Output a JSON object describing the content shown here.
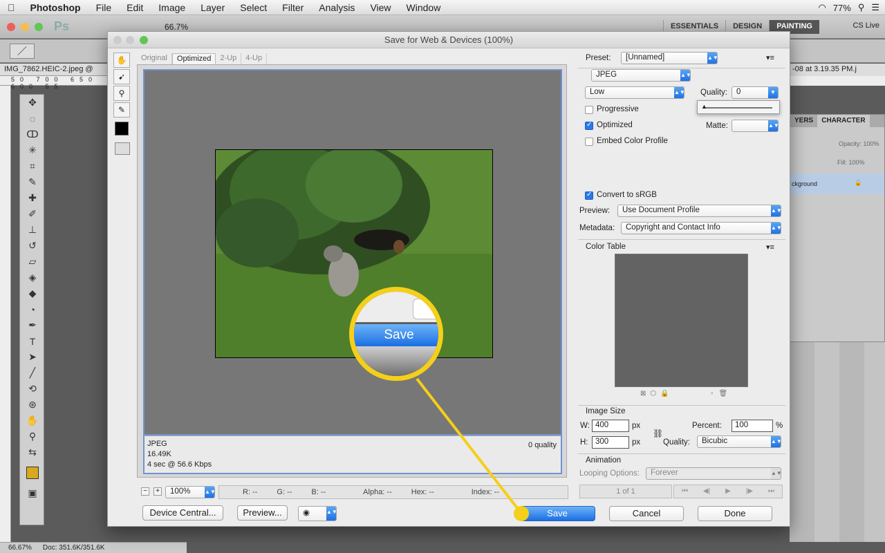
{
  "menubar": {
    "app": "Photoshop",
    "items": [
      "File",
      "Edit",
      "Image",
      "Layer",
      "Select",
      "Filter",
      "Analysis",
      "View",
      "Window"
    ],
    "battery": "77%"
  },
  "ps": {
    "zoom": "66.7%",
    "workspaces": [
      "ESSENTIALS",
      "DESIGN",
      "PAINTING"
    ],
    "cs_live": "CS Live",
    "doc_tab": "IMG_7862.HEIC-2.jpeg @",
    "ruler": "50 700 650 600 55",
    "status_zoom": "66.67%",
    "status_doc": "Doc: 351.6K/351.6K"
  },
  "bg": {
    "title": "-08 at 3.19.35 PM.j",
    "tabs": [
      "YERS",
      "CHARACTER"
    ],
    "opacity": "Opacity:",
    "opacity_val": "100%",
    "fill": "Fill:",
    "fill_val": "100%",
    "layer": "ckground"
  },
  "dialog": {
    "title": "Save for Web & Devices (100%)",
    "tabs": [
      "Original",
      "Optimized",
      "2-Up",
      "4-Up"
    ],
    "info": {
      "format": "JPEG",
      "size": "16.49K",
      "time": "4 sec @ 56.6 Kbps",
      "quality": "0 quality"
    },
    "zoom": "100%",
    "readouts": {
      "r": "R: --",
      "g": "G: --",
      "b": "B: --",
      "alpha": "Alpha: --",
      "hex": "Hex: --",
      "index": "Index: --"
    },
    "buttons": {
      "device_central": "Device Central...",
      "preview": "Preview...",
      "save": "Save",
      "cancel": "Cancel",
      "done": "Done"
    },
    "magnifier_label": "Save",
    "settings": {
      "preset_label": "Preset:",
      "preset": "[Unnamed]",
      "format": "JPEG",
      "compression": "Low",
      "quality_label": "Quality:",
      "quality": "0",
      "progressive": "Progressive",
      "optimized": "Optimized",
      "embed": "Embed Color Profile",
      "matte_label": "Matte:",
      "convert": "Convert to sRGB",
      "preview_label": "Preview:",
      "preview_value": "Use Document Profile",
      "metadata_label": "Metadata:",
      "metadata_value": "Copyright and Contact Info",
      "color_table": "Color Table",
      "image_size": "Image Size",
      "w_label": "W:",
      "w": "400",
      "h_label": "H:",
      "h": "300",
      "px": "px",
      "percent_label": "Percent:",
      "percent": "100",
      "pct": "%",
      "resample_label": "Quality:",
      "resample": "Bicubic",
      "animation": "Animation",
      "looping_label": "Looping Options:",
      "looping": "Forever",
      "frame": "1 of 1"
    },
    "checks": {
      "progressive": false,
      "optimized": true,
      "embed": false,
      "convert": true
    }
  },
  "colors": {
    "accent": "#1e6ee2",
    "callout": "#f5cf19"
  }
}
